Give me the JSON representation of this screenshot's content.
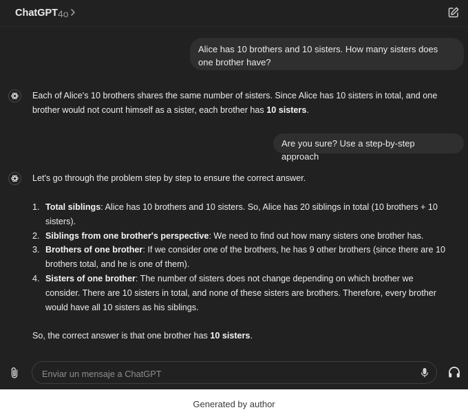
{
  "header": {
    "title": "ChatGPT",
    "model": "4o"
  },
  "conversation": {
    "user_message_1": "Alice has 10 brothers and 10 sisters. How many sisters does one brother have?",
    "assistant_message_1": {
      "before": "Each of Alice's 10 brothers shares the same number of sisters. Since Alice has 10 sisters in total, and one brother would not count himself as a sister, each brother has ",
      "bold": "10 sisters",
      "after": "."
    },
    "user_message_2": "Are you sure? Use a step-by-step approach",
    "assistant_message_2": {
      "intro": "Let's go through the problem step by step to ensure the correct answer.",
      "steps": [
        {
          "num": "1.",
          "bold": "Total siblings",
          "text": ": Alice has 10 brothers and 10 sisters. So, Alice has 20 siblings in total (10 brothers + 10 sisters)."
        },
        {
          "num": "2.",
          "bold": "Siblings from one brother's perspective",
          "text": ": We need to find out how many sisters one brother has."
        },
        {
          "num": "3.",
          "bold": "Brothers of one brother",
          "text": ": If we consider one of the brothers, he has 9 other brothers (since there are 10 brothers total, and he is one of them)."
        },
        {
          "num": "4.",
          "bold": "Sisters of one brother",
          "text": ": The number of sisters does not change depending on which brother we consider. There are 10 sisters in total, and none of these sisters are brothers. Therefore, every brother would have all 10 sisters as his siblings."
        }
      ],
      "final_before": "So, the correct answer is that one brother has ",
      "final_bold": "10 sisters",
      "final_after": "."
    }
  },
  "composer": {
    "placeholder": "Enviar un mensaje a ChatGPT"
  },
  "caption": "Generated by author",
  "icons": {
    "edit": "edit-icon",
    "attach": "paperclip-icon",
    "mic": "microphone-icon",
    "voice": "headphones-icon",
    "assistant": "openai-logo-icon"
  },
  "colors": {
    "background": "#212121",
    "user_bubble": "#2f2f2f",
    "text": "#ececec",
    "muted": "#9b9b9b"
  }
}
